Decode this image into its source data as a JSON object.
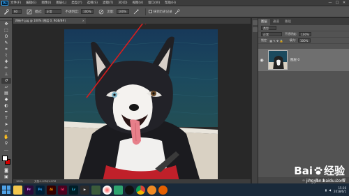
{
  "app": {
    "logo": "Ps"
  },
  "menu": [
    "文件(F)",
    "编辑(E)",
    "图像(I)",
    "图层(L)",
    "类型(Y)",
    "选择(S)",
    "滤镜(T)",
    "3D(D)",
    "视图(V)",
    "窗口(W)",
    "帮助(H)"
  ],
  "window_controls": {
    "minimize": "—",
    "maximize": "□",
    "close": "✕"
  },
  "options_bar": {
    "size": "60",
    "mode_label": "模式:",
    "mode_value": "正常",
    "opacity_label": "不透明度:",
    "opacity_value": "100%",
    "flow_label": "流量:",
    "flow_value": "100%",
    "history_label": "抹到历史记录"
  },
  "document_tab": {
    "label": "四街子.jpg @ 100% (图层 0, RGB/8#)",
    "close": "×"
  },
  "status_bar": {
    "zoom": "100%",
    "doc": "文档:1.07M/1.07M"
  },
  "layers_panel": {
    "tabs": [
      "图层",
      "通道",
      "路径"
    ],
    "kind_label": "类型",
    "blend_mode": "正常",
    "opacity_label": "不透明度:",
    "opacity_value": "100%",
    "lock_label": "锁定:",
    "fill_label": "填充:",
    "fill_value": "100%",
    "layer_name": "图层 0"
  },
  "taskbar": {
    "apps": [
      {
        "label": "Pr",
        "bg": "#2a0a3a",
        "fg": "#e77bff"
      },
      {
        "label": "Ps",
        "bg": "#001e36",
        "fg": "#31a8ff"
      },
      {
        "label": "Ai",
        "bg": "#330000",
        "fg": "#ff9a00"
      },
      {
        "label": "Id",
        "bg": "#49021f",
        "fg": "#ff3366"
      },
      {
        "label": "Lr",
        "bg": "#001d26",
        "fg": "#31c5f0"
      }
    ],
    "clock": "15:16",
    "date": "2018/6/1"
  },
  "watermark": {
    "main_left": "Bai",
    "main_right": "经验",
    "url": "jingyan.baidu.com"
  },
  "colors": {
    "foreground": "#ffffff",
    "background": "#d40000",
    "arrow": "#d81e1e"
  }
}
